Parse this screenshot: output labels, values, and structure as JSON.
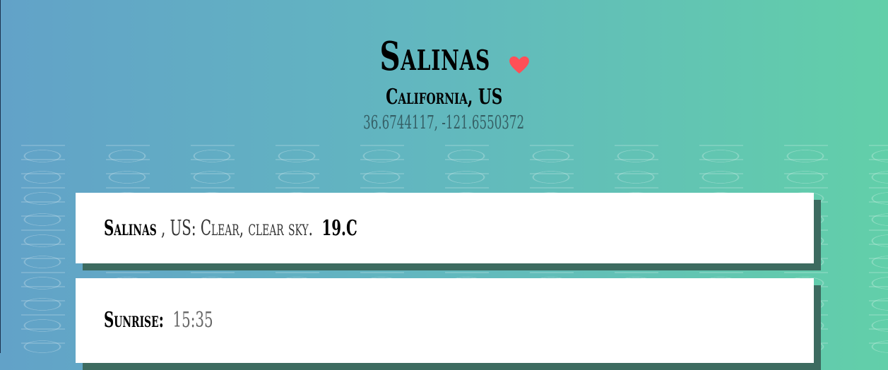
{
  "header": {
    "city": "Salinas",
    "favorite_icon": "heart-icon",
    "favorite_color": "#ff4f57",
    "region": "California, US",
    "coordinates": "36.6744117, -121.6550372"
  },
  "weather_card": {
    "city": "Salinas",
    "country_desc": ", US: Clear, clear sky.",
    "temperature": "19.C"
  },
  "sunrise_card": {
    "label": "Sunrise:",
    "time": "15:35"
  },
  "colors": {
    "gradient_start": "#62a2c8",
    "gradient_end": "#62cfa9",
    "card_bg": "#ffffff",
    "card_shadow": "#3d6b60"
  }
}
